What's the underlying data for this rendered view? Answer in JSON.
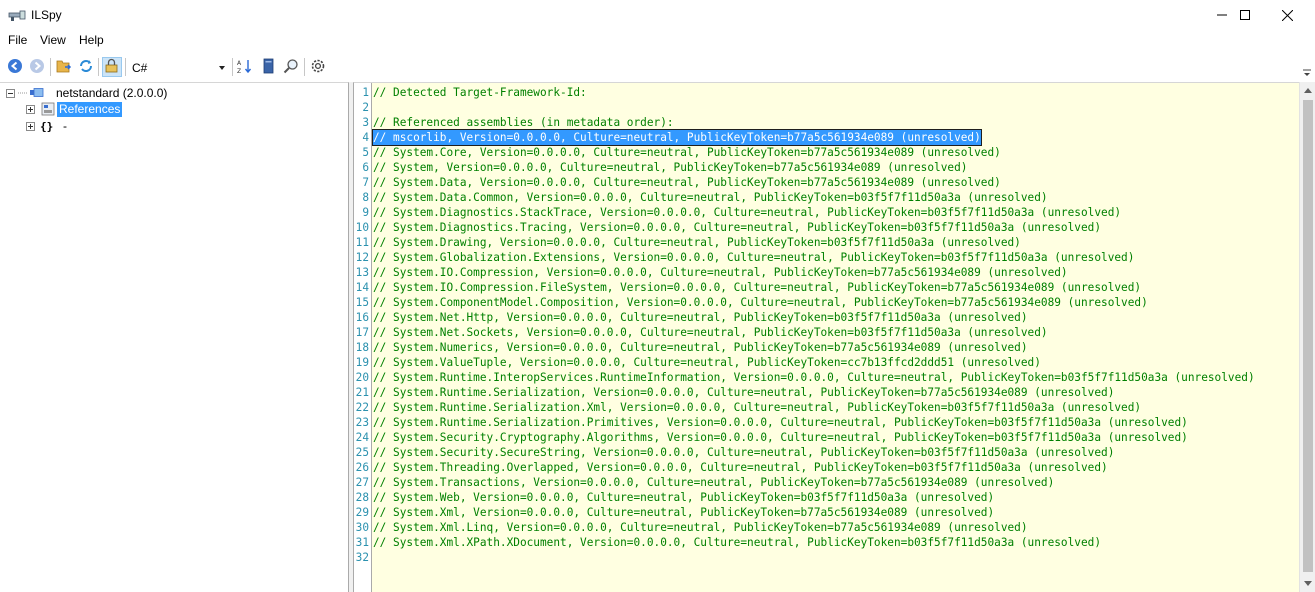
{
  "window": {
    "title": "ILSpy",
    "icon": "ilspy-app-icon",
    "controls": [
      "minimize-icon",
      "maximize-icon",
      "close-icon"
    ]
  },
  "menu": [
    {
      "label": "File"
    },
    {
      "label": "View"
    },
    {
      "label": "Help"
    }
  ],
  "toolbar": {
    "buttons": [
      {
        "name": "back-icon",
        "active": false
      },
      {
        "name": "forward-icon",
        "active": false
      },
      {
        "name": "open-icon",
        "active": false
      },
      {
        "name": "reload-icon",
        "active": false
      },
      {
        "name": "show-internal-icon",
        "active": true
      },
      {
        "name": "sort-icon",
        "active": false
      },
      {
        "name": "manage-assemblies-icon",
        "active": false
      },
      {
        "name": "search-icon",
        "active": false
      },
      {
        "name": "options-icon",
        "active": false
      }
    ],
    "language": "C#"
  },
  "tree": {
    "root": {
      "label": "netstandard (2.0.0.0)",
      "icon": "assembly-icon"
    },
    "children": [
      {
        "label": "References",
        "icon": "references-icon",
        "selected": true
      },
      {
        "label": "-",
        "icon": "namespace-icon",
        "selected": false
      }
    ]
  },
  "editor": {
    "selected_line": 4,
    "lines": [
      "// Detected Target-Framework-Id: ",
      "",
      "// Referenced assemblies (in metadata order):",
      "// mscorlib, Version=0.0.0.0, Culture=neutral, PublicKeyToken=b77a5c561934e089 (unresolved)",
      "// System.Core, Version=0.0.0.0, Culture=neutral, PublicKeyToken=b77a5c561934e089 (unresolved)",
      "// System, Version=0.0.0.0, Culture=neutral, PublicKeyToken=b77a5c561934e089 (unresolved)",
      "// System.Data, Version=0.0.0.0, Culture=neutral, PublicKeyToken=b77a5c561934e089 (unresolved)",
      "// System.Data.Common, Version=0.0.0.0, Culture=neutral, PublicKeyToken=b03f5f7f11d50a3a (unresolved)",
      "// System.Diagnostics.StackTrace, Version=0.0.0.0, Culture=neutral, PublicKeyToken=b03f5f7f11d50a3a (unresolved)",
      "// System.Diagnostics.Tracing, Version=0.0.0.0, Culture=neutral, PublicKeyToken=b03f5f7f11d50a3a (unresolved)",
      "// System.Drawing, Version=0.0.0.0, Culture=neutral, PublicKeyToken=b03f5f7f11d50a3a (unresolved)",
      "// System.Globalization.Extensions, Version=0.0.0.0, Culture=neutral, PublicKeyToken=b03f5f7f11d50a3a (unresolved)",
      "// System.IO.Compression, Version=0.0.0.0, Culture=neutral, PublicKeyToken=b77a5c561934e089 (unresolved)",
      "// System.IO.Compression.FileSystem, Version=0.0.0.0, Culture=neutral, PublicKeyToken=b77a5c561934e089 (unresolved)",
      "// System.ComponentModel.Composition, Version=0.0.0.0, Culture=neutral, PublicKeyToken=b77a5c561934e089 (unresolved)",
      "// System.Net.Http, Version=0.0.0.0, Culture=neutral, PublicKeyToken=b03f5f7f11d50a3a (unresolved)",
      "// System.Net.Sockets, Version=0.0.0.0, Culture=neutral, PublicKeyToken=b03f5f7f11d50a3a (unresolved)",
      "// System.Numerics, Version=0.0.0.0, Culture=neutral, PublicKeyToken=b77a5c561934e089 (unresolved)",
      "// System.ValueTuple, Version=0.0.0.0, Culture=neutral, PublicKeyToken=cc7b13ffcd2ddd51 (unresolved)",
      "// System.Runtime.InteropServices.RuntimeInformation, Version=0.0.0.0, Culture=neutral, PublicKeyToken=b03f5f7f11d50a3a (unresolved)",
      "// System.Runtime.Serialization, Version=0.0.0.0, Culture=neutral, PublicKeyToken=b77a5c561934e089 (unresolved)",
      "// System.Runtime.Serialization.Xml, Version=0.0.0.0, Culture=neutral, PublicKeyToken=b03f5f7f11d50a3a (unresolved)",
      "// System.Runtime.Serialization.Primitives, Version=0.0.0.0, Culture=neutral, PublicKeyToken=b03f5f7f11d50a3a (unresolved)",
      "// System.Security.Cryptography.Algorithms, Version=0.0.0.0, Culture=neutral, PublicKeyToken=b03f5f7f11d50a3a (unresolved)",
      "// System.Security.SecureString, Version=0.0.0.0, Culture=neutral, PublicKeyToken=b03f5f7f11d50a3a (unresolved)",
      "// System.Threading.Overlapped, Version=0.0.0.0, Culture=neutral, PublicKeyToken=b03f5f7f11d50a3a (unresolved)",
      "// System.Transactions, Version=0.0.0.0, Culture=neutral, PublicKeyToken=b77a5c561934e089 (unresolved)",
      "// System.Web, Version=0.0.0.0, Culture=neutral, PublicKeyToken=b03f5f7f11d50a3a (unresolved)",
      "// System.Xml, Version=0.0.0.0, Culture=neutral, PublicKeyToken=b77a5c561934e089 (unresolved)",
      "// System.Xml.Linq, Version=0.0.0.0, Culture=neutral, PublicKeyToken=b77a5c561934e089 (unresolved)",
      "// System.Xml.XPath.XDocument, Version=0.0.0.0, Culture=neutral, PublicKeyToken=b03f5f7f11d50a3a (unresolved)",
      ""
    ]
  }
}
